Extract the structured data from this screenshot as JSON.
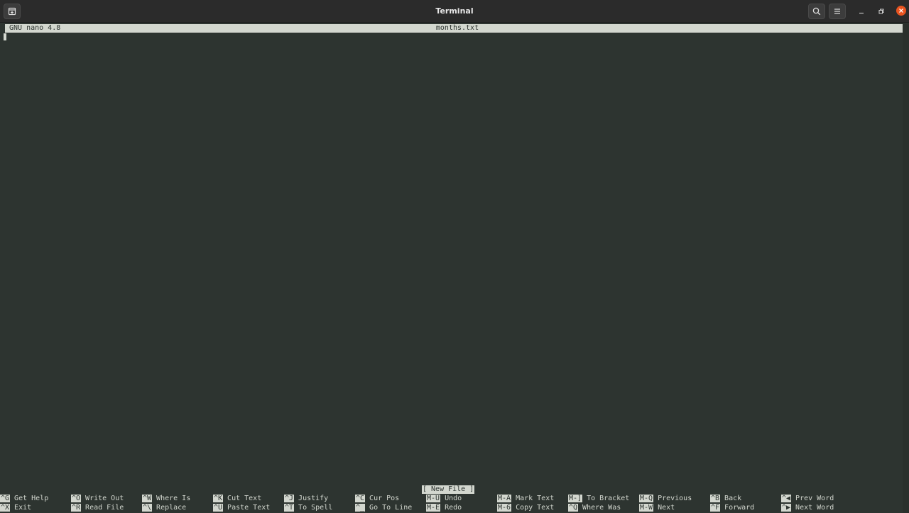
{
  "window": {
    "title": "Terminal"
  },
  "nano": {
    "version": "GNU nano 4.8",
    "filename": "months.txt",
    "status_message": "[ New File ]"
  },
  "shortcuts": {
    "row1": [
      {
        "key": "^G",
        "label": "Get Help"
      },
      {
        "key": "^O",
        "label": "Write Out"
      },
      {
        "key": "^W",
        "label": "Where Is"
      },
      {
        "key": "^K",
        "label": "Cut Text"
      },
      {
        "key": "^J",
        "label": "Justify"
      },
      {
        "key": "^C",
        "label": "Cur Pos"
      },
      {
        "key": "M-U",
        "label": "Undo"
      },
      {
        "key": "M-A",
        "label": "Mark Text"
      },
      {
        "key": "M-]",
        "label": "To Bracket"
      },
      {
        "key": "M-Q",
        "label": "Previous"
      },
      {
        "key": "^B",
        "label": "Back"
      },
      {
        "key": "^◀",
        "label": "Prev Word"
      }
    ],
    "row2": [
      {
        "key": "^X",
        "label": "Exit"
      },
      {
        "key": "^R",
        "label": "Read File"
      },
      {
        "key": "^\\",
        "label": "Replace"
      },
      {
        "key": "^U",
        "label": "Paste Text"
      },
      {
        "key": "^T",
        "label": "To Spell"
      },
      {
        "key": "^_",
        "label": "Go To Line"
      },
      {
        "key": "M-E",
        "label": "Redo"
      },
      {
        "key": "M-6",
        "label": "Copy Text"
      },
      {
        "key": "^Q",
        "label": "Where Was"
      },
      {
        "key": "M-W",
        "label": "Next"
      },
      {
        "key": "^F",
        "label": "Forward"
      },
      {
        "key": "^▶",
        "label": "Next Word"
      }
    ]
  },
  "icons": {
    "new_tab": "new-tab-icon",
    "search": "search-icon",
    "menu": "hamburger-menu-icon",
    "minimize": "minimize-icon",
    "restore": "restore-icon",
    "close": "close-icon"
  }
}
